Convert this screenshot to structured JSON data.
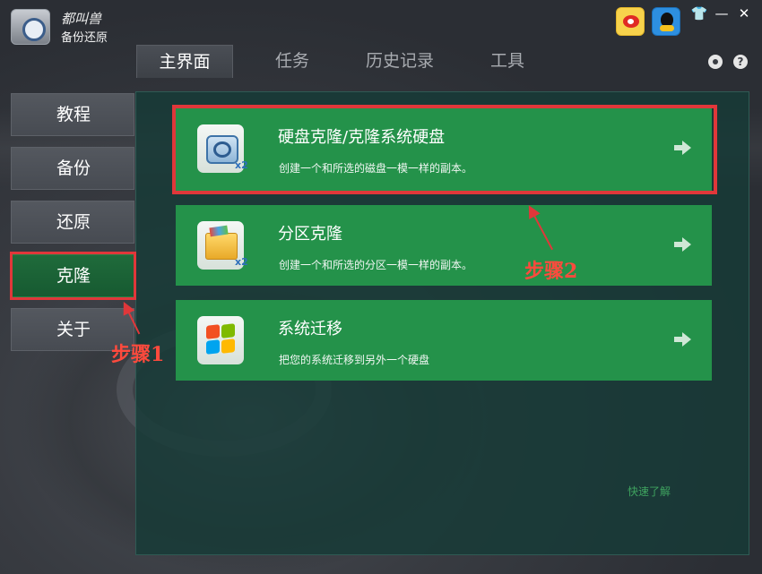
{
  "app": {
    "brand_top": "都叫兽",
    "brand_bottom": "备份还原"
  },
  "icons": {
    "logo": "safe-logo-icon",
    "weibo": "weibo-icon",
    "qq": "qq-icon",
    "skin": "shirt-icon",
    "minimize": "minimize-icon",
    "close": "close-icon",
    "settings": "gear-icon",
    "help": "help-icon"
  },
  "window_controls": {
    "skin": "👕",
    "minimize": "—",
    "close": "✕",
    "help": "?"
  },
  "tabs": [
    {
      "label": "主界面",
      "active": true
    },
    {
      "label": "任务",
      "active": false
    },
    {
      "label": "历史记录",
      "active": false
    },
    {
      "label": "工具",
      "active": false
    }
  ],
  "sidebar": {
    "items": [
      {
        "label": "教程"
      },
      {
        "label": "备份"
      },
      {
        "label": "还原"
      },
      {
        "label": "克隆",
        "selected": true
      },
      {
        "label": "关于"
      }
    ]
  },
  "cards": [
    {
      "title": "硬盘克隆/克隆系统硬盘",
      "description": "创建一个和所选的磁盘一模一样的副本。",
      "badge": "x2",
      "icon": "disk-icon"
    },
    {
      "title": "分区克隆",
      "description": "创建一个和所选的分区一模一样的副本。",
      "badge": "x2",
      "icon": "folder-icon"
    },
    {
      "title": "系统迁移",
      "description": "把您的系统迁移到另外一个硬盘",
      "icon": "windows-icon"
    }
  ],
  "annotations": {
    "step1": "步骤1",
    "step2": "步骤2"
  },
  "quick_link": "快速了解",
  "colors": {
    "card_green": "#24924a",
    "panel_teal": "#163a37",
    "highlight_red": "#e0373a",
    "annotation_text": "#ff4a3d",
    "quick_link": "#3fa35f"
  }
}
